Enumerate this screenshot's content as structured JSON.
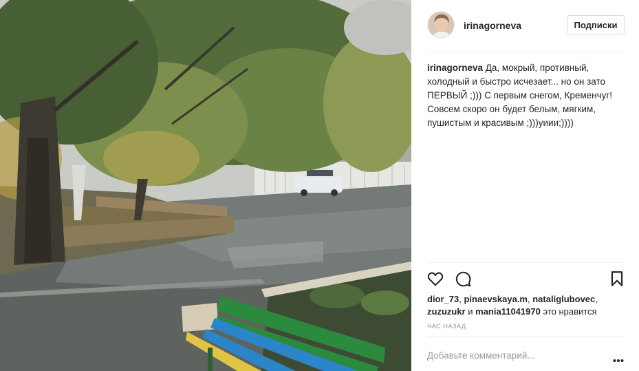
{
  "post": {
    "username": "irinagorneva",
    "follow_label": "Подписки",
    "caption_user": "irinagorneva",
    "caption_text": " Да, мокрый, противный, холодный и быстро исчезает... но он зато ПЕРВЫЙ ;))) С первым снегом, Кременчуг! Совсем скоро он будет белым, мягким, пушистым и красивым ;)))уиии;))))",
    "likes": {
      "users": [
        "dior_73",
        "pinaevskaya.m",
        "nataliglubovec",
        "zuzuzukr"
      ],
      "last_user": "mania11041970",
      "joiner": "и",
      "suffix": "это нравится"
    },
    "timestamp": "час назад",
    "comment_placeholder": "Добавьте комментарий...",
    "icons": [
      "heart-icon",
      "comment-icon",
      "bookmark-icon",
      "more-options-icon"
    ]
  }
}
